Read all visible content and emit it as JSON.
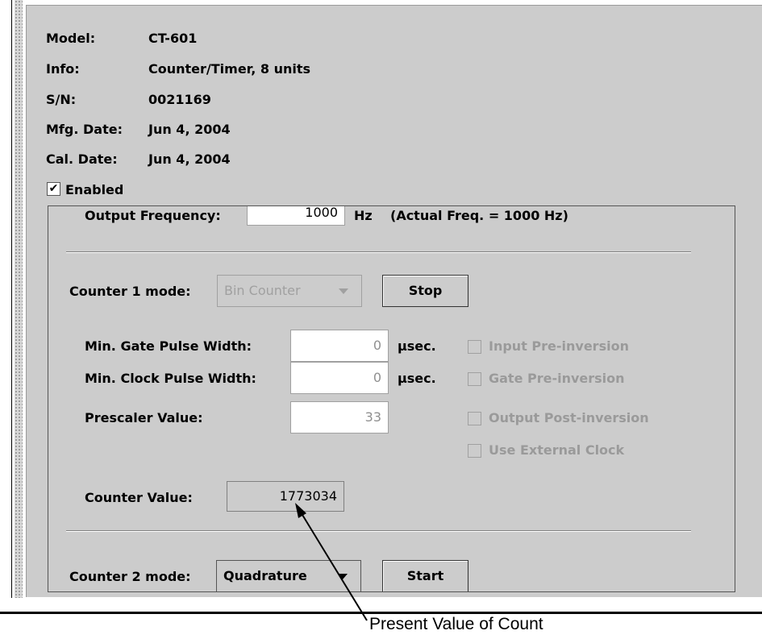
{
  "device_info": {
    "rows": [
      {
        "label": "Model:",
        "value": "CT-601"
      },
      {
        "label": "Info:",
        "value": "Counter/Timer, 8 units"
      },
      {
        "label": "S/N:",
        "value": "0021169"
      },
      {
        "label": "Mfg. Date:",
        "value": "Jun 4, 2004"
      },
      {
        "label": "Cal. Date:",
        "value": "Jun 4, 2004"
      }
    ],
    "enabled_label": "Enabled",
    "enabled_check": "✔"
  },
  "output": {
    "label": "Output Frequency:",
    "value": "1000",
    "unit": "Hz",
    "actual": "(Actual Freq. = 1000 Hz)"
  },
  "counter1": {
    "mode_label": "Counter 1 mode:",
    "mode_value": "Bin Counter",
    "button_label": "Stop",
    "gate_label": "Min. Gate Pulse Width:",
    "gate_value": "0",
    "gate_unit": "µsec.",
    "clock_label": "Min. Clock Pulse Width:",
    "clock_value": "0",
    "clock_unit": "µsec.",
    "prescaler_label": "Prescaler Value:",
    "prescaler_value": "33",
    "options": [
      "Input Pre-inversion",
      "Gate Pre-inversion",
      "Output Post-inversion",
      "Use External Clock"
    ],
    "counter_value_label": "Counter Value:",
    "counter_value": "1773034"
  },
  "counter2": {
    "mode_label": "Counter 2 mode:",
    "mode_value": "Quadrature",
    "button_label": "Start"
  },
  "annotation": {
    "text": "Present Value of Count"
  }
}
